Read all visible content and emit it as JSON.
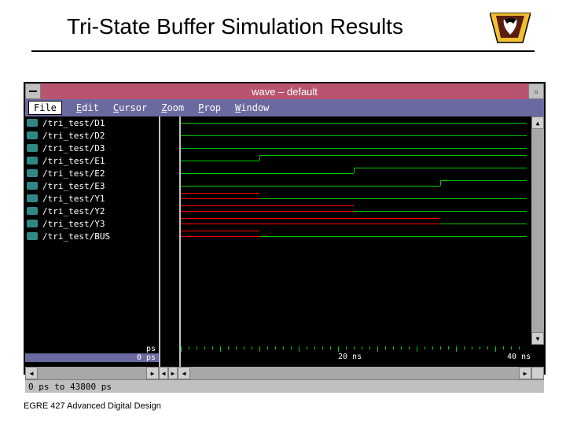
{
  "slide": {
    "title": "Tri-State Buffer Simulation Results",
    "footer": "EGRE 427 Advanced Digital Design"
  },
  "window": {
    "title": "wave – default",
    "menus": {
      "file": "File",
      "edit": "Edit",
      "cursor": "Cursor",
      "zoom": "Zoom",
      "prop": "Prop",
      "window": "Window"
    },
    "status": "0 ps to 43800 ps",
    "time_unit": "ps",
    "cursor_time": "0 ps",
    "ruler_labels": {
      "t20": "20 ns",
      "t40": "40 ns"
    }
  },
  "signals": [
    {
      "name": "/tri_test/D1"
    },
    {
      "name": "/tri_test/D2"
    },
    {
      "name": "/tri_test/D3"
    },
    {
      "name": "/tri_test/E1"
    },
    {
      "name": "/tri_test/E2"
    },
    {
      "name": "/tri_test/E3"
    },
    {
      "name": "/tri_test/Y1"
    },
    {
      "name": "/tri_test/Y2"
    },
    {
      "name": "/tri_test/Y3"
    },
    {
      "name": "/tri_test/BUS"
    }
  ]
}
